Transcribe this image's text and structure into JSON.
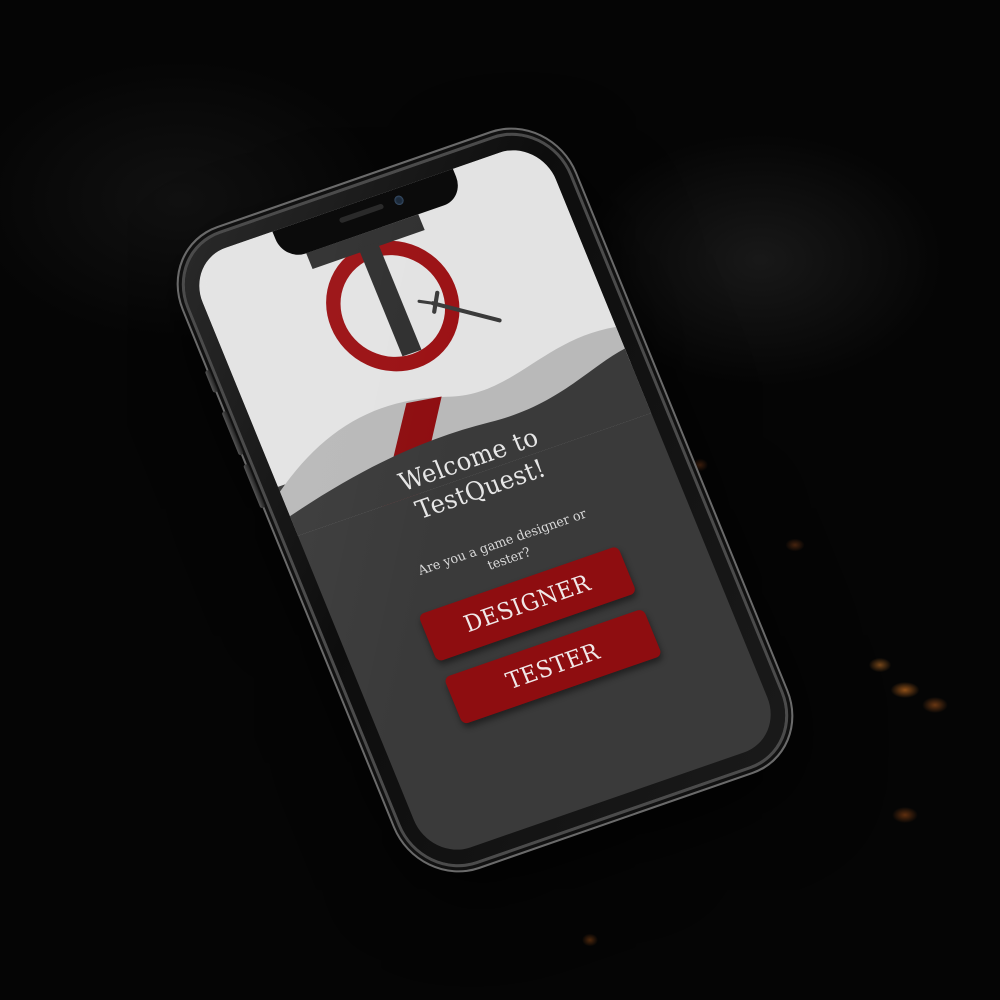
{
  "app": {
    "welcome_title": "Welcome to TestQuest!",
    "question": "Are you a game designer or tester?",
    "logo": {
      "icon": "testquest-logo-icon",
      "accent_color": "#9b1114",
      "dark_color": "#2f2f2f"
    }
  },
  "actions": {
    "designer_label": "DESIGNER",
    "tester_label": "TESTER"
  },
  "theme": {
    "button_color": "#8e0d10",
    "screen_dark": "#3a3a3a",
    "screen_light": "#e3e3e3"
  }
}
